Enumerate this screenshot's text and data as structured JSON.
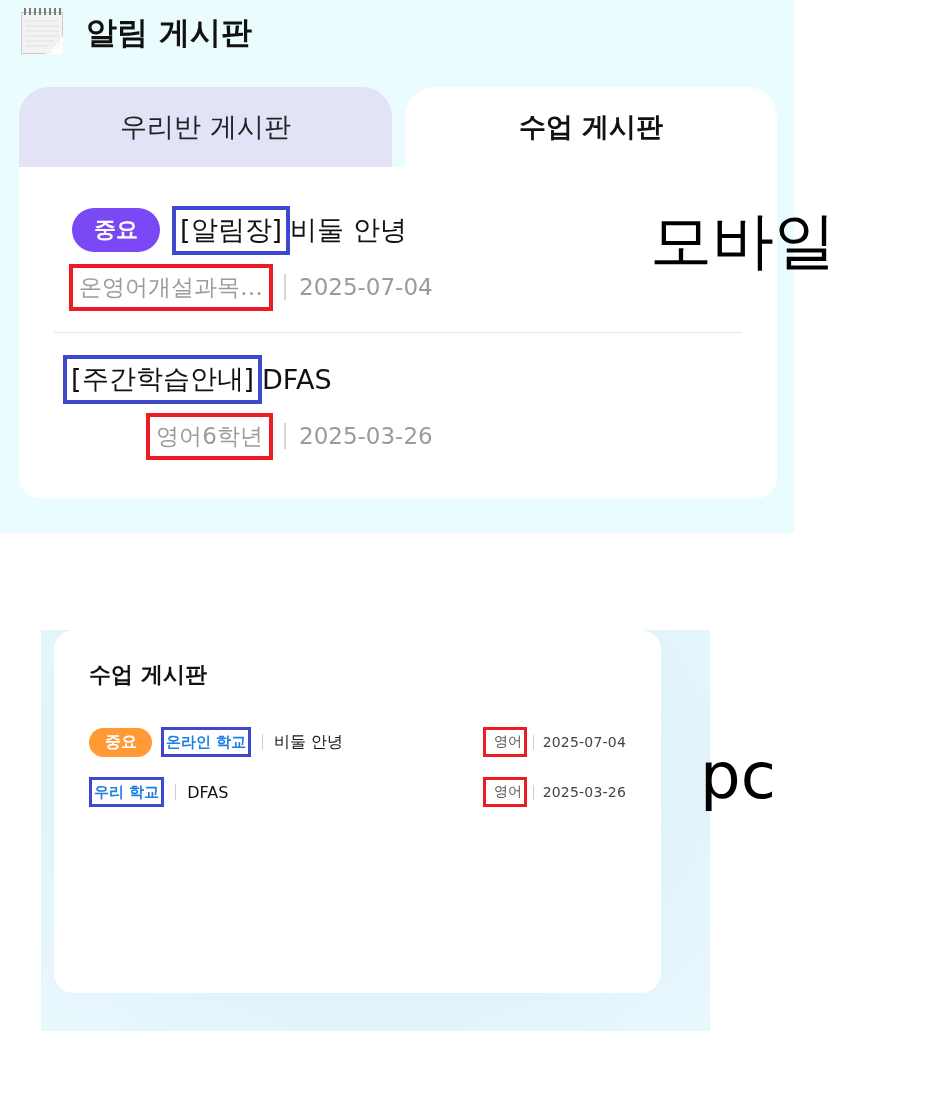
{
  "mobile": {
    "title": "알림 게시판",
    "tabs": [
      {
        "label": "우리반 게시판",
        "selected": false
      },
      {
        "label": "수업 게시판",
        "selected": true
      }
    ],
    "posts": [
      {
        "badge": "중요",
        "label": {
          "text": "[알림장]",
          "marked": true
        },
        "title": "비둘 안녕",
        "subject": {
          "text": "온영어개설과목…",
          "marked": true
        },
        "date": "2025-07-04"
      },
      {
        "label": {
          "text": "[주간학습안내]",
          "marked": true
        },
        "title": "DFAS",
        "subject": {
          "text": "영어6학년",
          "marked": true
        },
        "date": "2025-03-26"
      }
    ],
    "caption": "모바일"
  },
  "pc": {
    "title": "수업 게시판",
    "posts": [
      {
        "badge": "중요",
        "label": {
          "text": "온라인 학교",
          "marked": true
        },
        "title": "비둘 안녕",
        "subject": {
          "text": "영어",
          "marked": true
        },
        "date": "2025-07-04"
      },
      {
        "label": {
          "text": "우리 학교",
          "marked": true
        },
        "title": "DFAS",
        "subject": {
          "text": "영어",
          "marked": true
        },
        "date": "2025-03-26"
      }
    ],
    "caption": "pc"
  }
}
